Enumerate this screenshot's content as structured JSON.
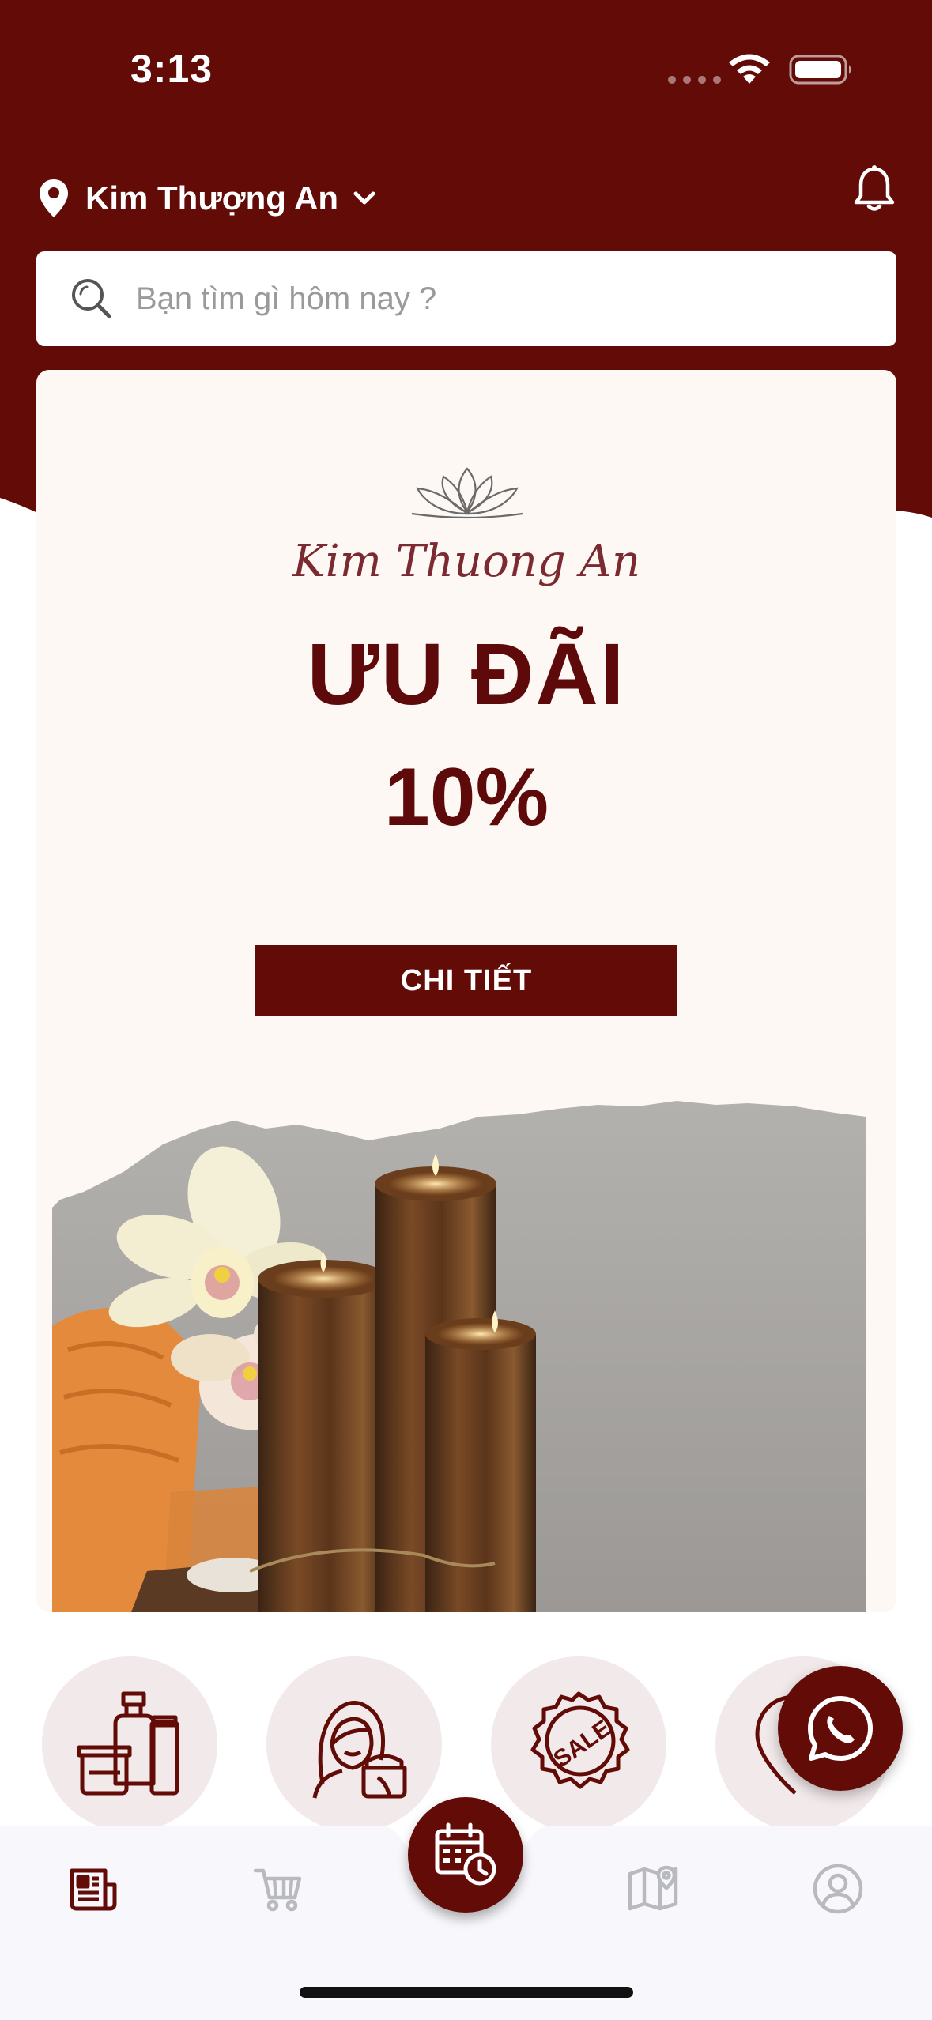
{
  "status_bar": {
    "time": "3:13"
  },
  "header": {
    "location": "Kim Thượng An",
    "search_placeholder": "Bạn tìm gì hôm nay ?"
  },
  "banner": {
    "brand": "Kim Thuong An",
    "title": "ƯU ĐÃI",
    "percent": "10%",
    "button": "CHI TIẾT"
  },
  "sale_badge_text": "SALE",
  "categories": [
    {
      "icon": "cosmetics-icon"
    },
    {
      "icon": "skincare-woman-icon"
    },
    {
      "icon": "sale-badge-icon"
    },
    {
      "icon": "location-icon"
    }
  ],
  "tabs": [
    {
      "icon": "news-icon",
      "active": true
    },
    {
      "icon": "cart-icon",
      "active": false
    },
    {
      "icon": "calendar-clock-icon",
      "active": false
    },
    {
      "icon": "map-icon",
      "active": false
    },
    {
      "icon": "profile-icon",
      "active": false
    }
  ],
  "colors": {
    "primary": "#620b07",
    "banner_bg": "#fdf8f4",
    "category_bg": "#f2eaea",
    "inactive_tab": "#b9b9c0"
  }
}
